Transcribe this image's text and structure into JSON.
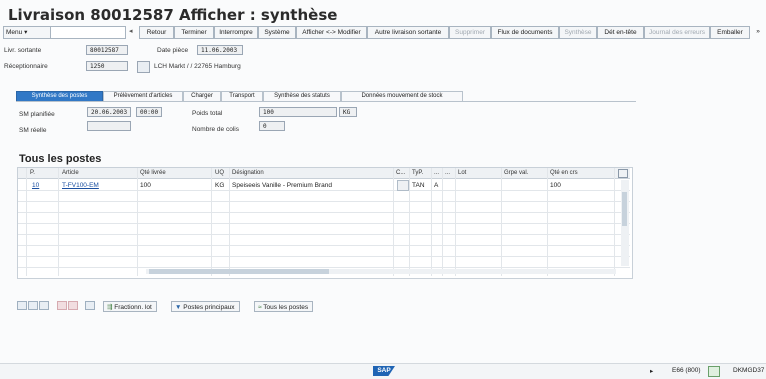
{
  "window": {
    "title": "Livraison 80012587 Afficher : synthèse"
  },
  "toolbar": {
    "menu": "Menu",
    "items": [
      "Retour",
      "Terminer",
      "Interrompre",
      "Système",
      "Afficher <-> Modifier",
      "Autre livraison sortante",
      "Supprimer",
      "Flux de documents",
      "Synthèse",
      "Dét en-tête",
      "Journal des erreurs",
      "Emballer"
    ],
    "more": "»"
  },
  "header": {
    "livr_sortante_label": "Livr. sortante",
    "livr_sortante_value": "80012587",
    "date_piece_label": "Date pièce",
    "date_piece_value": "11.06.2003",
    "receptionnaire_label": "Réceptionnaire",
    "receptionnaire_value": "1250",
    "receptionnaire_name": "LCH Markt / / 22765 Hamburg"
  },
  "tabs": [
    "Synthèse des postes",
    "Prélèvement d'articles",
    "Charger",
    "Transport",
    "Synthèse des statuts",
    "Données mouvement de stock"
  ],
  "overview": {
    "sm_planifiee_label": "SM planifiée",
    "sm_planifiee_date": "20.06.2003",
    "sm_planifiee_time": "00:00",
    "sm_reelle_label": "SM réelle",
    "poids_total_label": "Poids total",
    "poids_total_value": "100",
    "poids_unit": "KG",
    "nb_colis_label": "Nombre de colis",
    "nb_colis_value": "0"
  },
  "items_section": {
    "title": "Tous les postes"
  },
  "table": {
    "columns": [
      "P.",
      "Article",
      "Qté livrée",
      "UQ",
      "Désignation",
      "C...",
      "TyP.",
      "...",
      "...",
      "Lot",
      "Grpe val.",
      "Qté en crs"
    ],
    "rows": [
      {
        "p": "10",
        "article": "T-FV100-EM",
        "qte": "100",
        "uq": "KG",
        "designation": "Speiseeis Vanille - Premium Brand",
        "typ": "TAN",
        "flag": "A",
        "qte_crs": "100"
      }
    ]
  },
  "bottom_buttons": {
    "fraction": "Fractionn. lot",
    "postes_principaux": "Postes principaux",
    "tous_postes": "Tous les postes"
  },
  "status": {
    "logo": "SAP",
    "system": "E66 (800)",
    "user": "DKMGD37"
  }
}
